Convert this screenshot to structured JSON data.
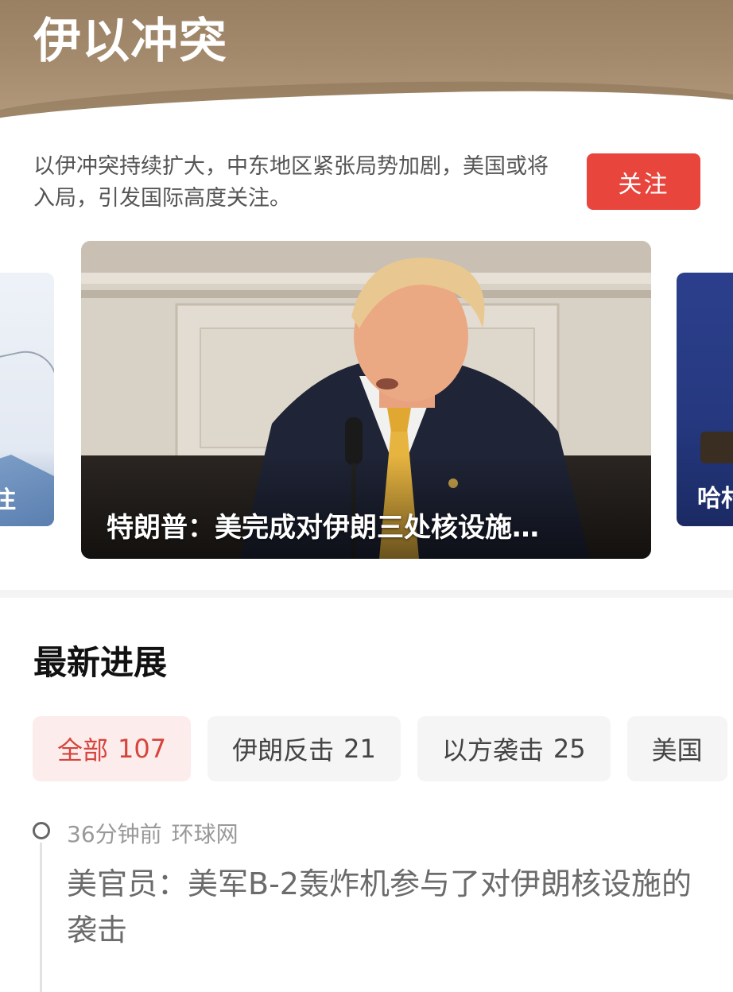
{
  "header": {
    "title": "伊以冲突"
  },
  "intro": {
    "text": "以伊冲突持续扩大，中东地区紧张局势加剧，美国或将入局，引发国际高度关注。",
    "follow_label": "关注"
  },
  "carousel": {
    "main_caption": "特朗普：美完成对伊朗三处核设施…",
    "left_caption": "注",
    "right_caption": "哈村"
  },
  "section": {
    "title": "最新进展"
  },
  "filters": [
    {
      "label": "全部",
      "count": "107",
      "active": true
    },
    {
      "label": "伊朗反击",
      "count": "21",
      "active": false
    },
    {
      "label": "以方袭击",
      "count": "25",
      "active": false
    },
    {
      "label": "美国",
      "count": "",
      "active": false
    }
  ],
  "timeline": [
    {
      "time": "36分钟前",
      "source": "环球网",
      "headline": "美官员：美军B-2轰炸机参与了对伊朗核设施的袭击"
    }
  ],
  "colors": {
    "accent": "#e8453c",
    "header_bg": "#a48a6c",
    "chip_active_bg": "#fdecec",
    "chip_active_text": "#d6453d"
  }
}
